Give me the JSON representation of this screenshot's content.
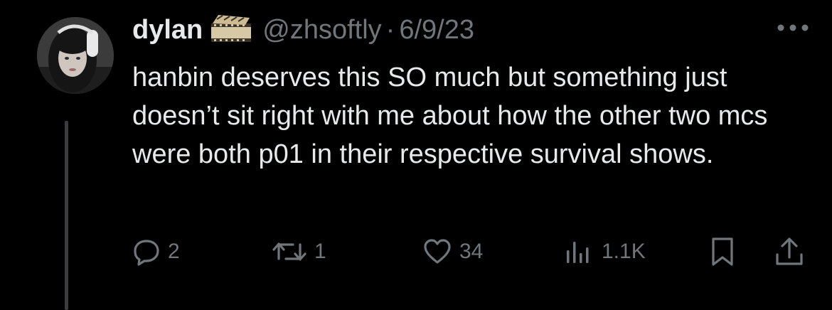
{
  "tweet": {
    "author": {
      "display_name": "dylan",
      "badge_icon": "film-strip-icon",
      "handle": "@zhsoftly",
      "separator": "·",
      "date": "6/9/23"
    },
    "text": "hanbin deserves this SO much but something just doesn’t sit right with me about how the other two mcs were both p01 in their respective survival shows.",
    "stats": {
      "replies": "2",
      "retweets": "1",
      "likes": "34",
      "views": "1.1K"
    }
  },
  "colors": {
    "background": "#000000",
    "primary_text": "#e7e9ea",
    "secondary_text": "#71767b",
    "thread_line": "#3a3d40"
  }
}
